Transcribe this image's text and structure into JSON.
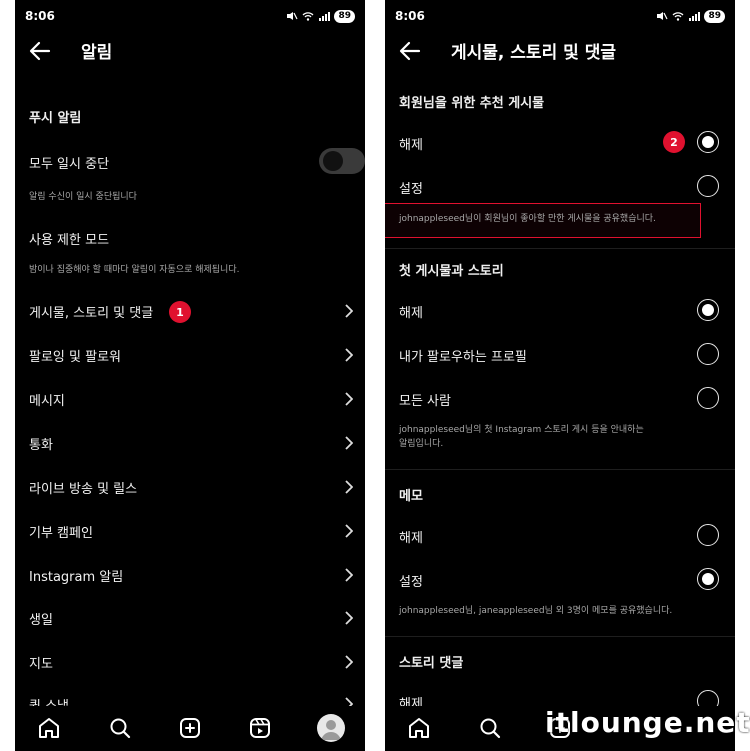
{
  "status_bar": {
    "time": "8:06",
    "battery": "89"
  },
  "left": {
    "title": "알림",
    "push_section": "푸시 알림",
    "pause_all": "모두 일시 중단",
    "pause_desc": "알림 수신이 일시 중단됩니다",
    "restrict_mode": "사용 제한 모드",
    "restrict_desc": "밤이나 집중해야 할 때마다 알림이 자동으로 해제됩니다.",
    "badge": "1",
    "menu_items": [
      "게시물, 스토리 및 댓글",
      "팔로잉 및 팔로워",
      "메시지",
      "통화",
      "라이브 방송 및 릴스",
      "기부 캠페인",
      "Instagram 알림",
      "생일",
      "지도",
      "퀵 스냅"
    ]
  },
  "right": {
    "title": "게시물, 스토리 및 댓글",
    "section1": "회원님을 위한 추천 게시물",
    "s1_off": "해제",
    "s1_on": "설정",
    "badge": "2",
    "s1_desc": "johnappleseed님이 회원님이 좋아할 만한 게시물을 공유했습니다.",
    "section2": "첫 게시물과 스토리",
    "s2_off": "해제",
    "s2_following": "내가 팔로우하는 프로필",
    "s2_everyone": "모든 사람",
    "s2_desc_line1": "johnappleseed님의 첫 Instagram 스토리 게시 등을 안내하는",
    "s2_desc_line2": "알림입니다.",
    "section3": "메모",
    "s3_off": "해제",
    "s3_on": "설정",
    "s3_desc": "johnappleseed님, janeappleseed님 외 3명이 메모를 공유했습니다.",
    "section4": "스토리 댓글",
    "s4_off": "해제"
  },
  "watermark": "itlounge.net",
  "colors": {
    "background": "#000000",
    "badge": "#e0112f",
    "text": "#f5f5f5",
    "muted": "#a8a8a8"
  },
  "icons": [
    "back-arrow-icon",
    "chevron-right-icon",
    "home-icon",
    "search-icon",
    "create-icon",
    "reels-icon",
    "profile-avatar",
    "mute-icon",
    "wifi-icon",
    "signal-icon"
  ]
}
